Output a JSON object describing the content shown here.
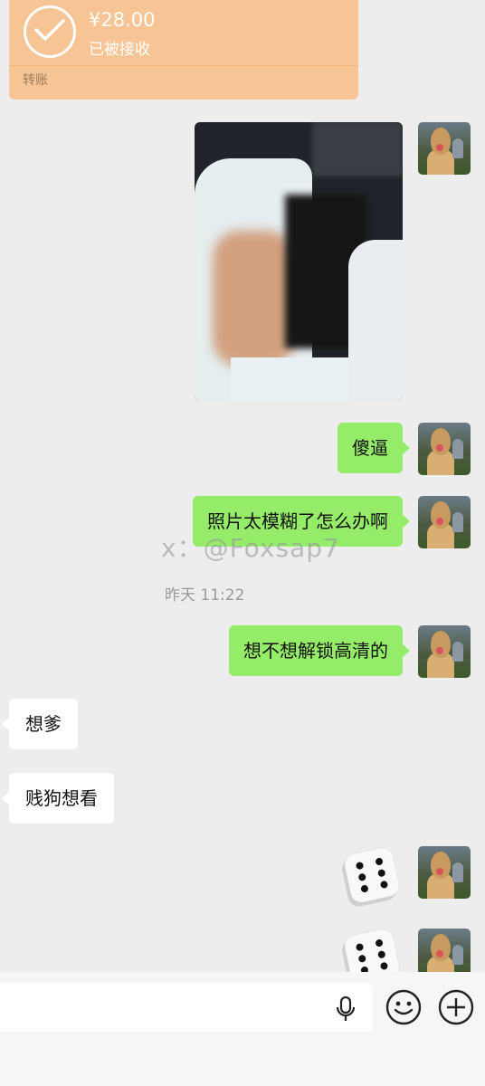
{
  "transfer": {
    "amount": "¥28.00",
    "status": "已被接收",
    "footer": "转账"
  },
  "messages": [
    {
      "side": "right",
      "type": "image"
    },
    {
      "side": "right",
      "type": "text",
      "text": "傻逼"
    },
    {
      "side": "right",
      "type": "text",
      "text": "照片太模糊了怎么办啊"
    },
    {
      "side": "right",
      "type": "text",
      "text": "想不想解锁高清的"
    },
    {
      "side": "left",
      "type": "text",
      "text": "想爹"
    },
    {
      "side": "left",
      "type": "text",
      "text": "贱狗想看"
    },
    {
      "side": "right",
      "type": "dice",
      "face": 6
    },
    {
      "side": "right",
      "type": "dice",
      "face": 6
    }
  ],
  "watermark": "x：@Foxsap7",
  "timestamp": "昨天 11:22",
  "input_bar": {
    "icons": [
      "microphone-icon",
      "emoji-icon",
      "plus-icon"
    ]
  },
  "colors": {
    "background": "#ededed",
    "sent_bubble": "#95ec69",
    "received_bubble": "#ffffff",
    "transfer_card": "#f7c495"
  }
}
